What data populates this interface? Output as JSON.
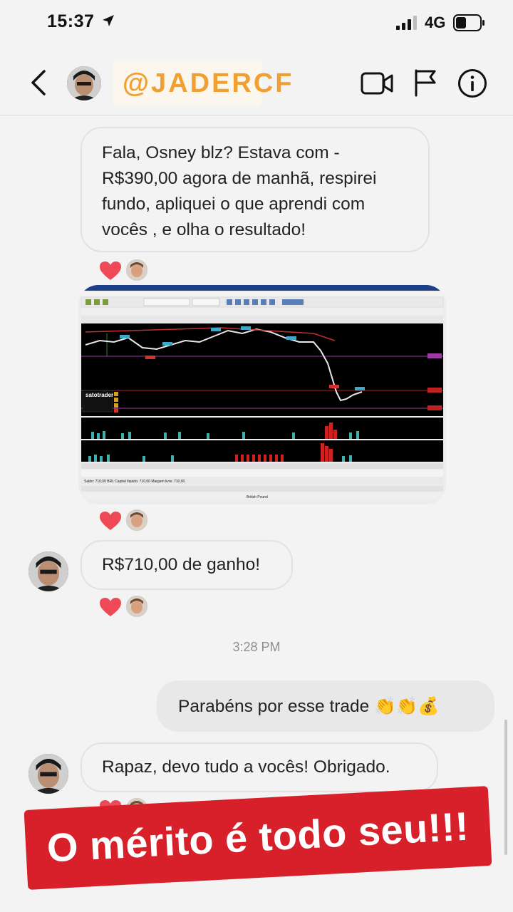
{
  "status_bar": {
    "time": "15:37",
    "network": "4G"
  },
  "header": {
    "username": "@JADERCF"
  },
  "messages": [
    {
      "text": "Fala, Osney  blz? Estava com - R$390,00 agora de manhã, respirei fundo, apliquei o que aprendi com vocês , e olha o resultado!"
    },
    {
      "text": "R$710,00 de ganho!"
    },
    {
      "text": "Parabéns por esse trade 👏👏💰"
    },
    {
      "text": "Rapaz, devo tudo a vocês! Obrigado."
    }
  ],
  "timestamp": "3:28 PM",
  "banner": {
    "text": "O mérito é todo seu!!!",
    "color": "#d7202a"
  },
  "screenshot": {
    "logo": "satotrader",
    "bottom_row": "Saldo: 710,00 BRL  Capital líquido: 710,00  Margem livre: 710,00",
    "footer_label": "British Pound"
  },
  "colors": {
    "accent": "#f0a030",
    "heart": "#ed4956",
    "bubble_border": "#e2e2e2"
  }
}
